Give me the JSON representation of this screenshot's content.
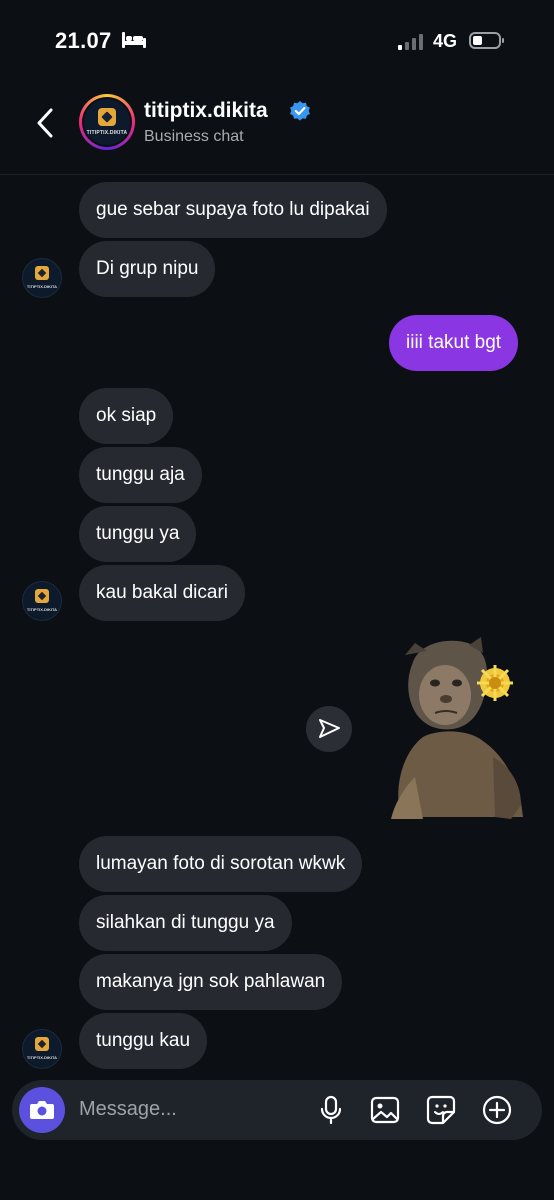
{
  "status_bar": {
    "time": "21.07",
    "network": "4G"
  },
  "header": {
    "username": "titiptix.dikita",
    "subtitle": "Business chat",
    "avatar_text": "TITIPTIX.DIKITA"
  },
  "messages": [
    {
      "sender": "them",
      "text": "gue sebar supaya foto lu dipakai"
    },
    {
      "sender": "them",
      "text": "Di grup nipu"
    },
    {
      "sender": "me",
      "text": "iiii takut bgt"
    },
    {
      "sender": "them",
      "text": "ok siap"
    },
    {
      "sender": "them",
      "text": "tunggu aja"
    },
    {
      "sender": "them",
      "text": "tunggu ya"
    },
    {
      "sender": "them",
      "text": "kau bakal dicari"
    },
    {
      "sender": "them",
      "type": "sticker",
      "icon": "monkey-sticker"
    },
    {
      "sender": "them",
      "text": "lumayan foto di sorotan wkwk"
    },
    {
      "sender": "them",
      "text": "silahkan di tunggu ya"
    },
    {
      "sender": "them",
      "text": "makanya jgn sok pahlawan"
    },
    {
      "sender": "them",
      "text": "tunggu kau"
    }
  ],
  "composer": {
    "placeholder": "Message..."
  },
  "colors": {
    "background": "#0c1015",
    "incoming_bubble": "#262a30",
    "outgoing_bubble": "#8a36e3",
    "camera_button": "#5b51de",
    "verified": "#3897f0"
  }
}
